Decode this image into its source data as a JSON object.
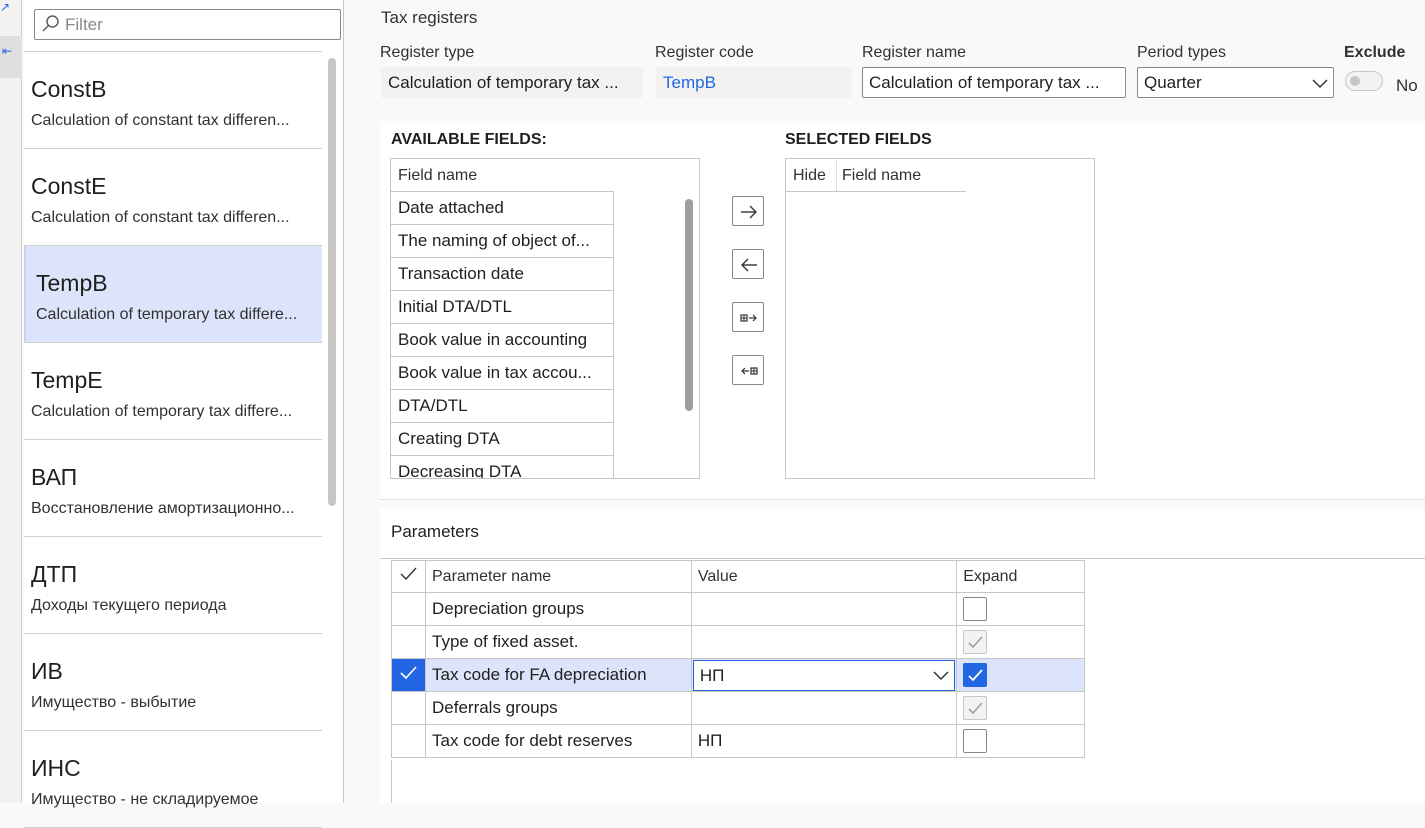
{
  "filter": {
    "placeholder": "Filter"
  },
  "list": [
    {
      "title": "ConstB",
      "desc": "Calculation of constant tax differen..."
    },
    {
      "title": "ConstE",
      "desc": "Calculation of constant tax differen..."
    },
    {
      "title": "TempB",
      "desc": "Calculation of temporary tax differe...",
      "selected": true
    },
    {
      "title": "TempE",
      "desc": "Calculation of temporary tax differe..."
    },
    {
      "title": "ВАП",
      "desc": "Восстановление амортизационно..."
    },
    {
      "title": "ДТП",
      "desc": "Доходы текущего периода"
    },
    {
      "title": "ИВ",
      "desc": "Имущество - выбытие"
    },
    {
      "title": "ИНС",
      "desc": "Имущество - не складируемое"
    }
  ],
  "header": {
    "page_title": "Tax registers",
    "register_type_label": "Register type",
    "register_type_value": "Calculation of temporary tax ...",
    "register_code_label": "Register code",
    "register_code_value": "TempB",
    "register_name_label": "Register name",
    "register_name_value": "Calculation of temporary tax ...",
    "period_types_label": "Period types",
    "period_types_value": "Quarter",
    "exclude_label": "Exclude",
    "exclude_value": "No"
  },
  "fields": {
    "available_title": "AVAILABLE FIELDS:",
    "selected_title": "SELECTED FIELDS",
    "field_name_header": "Field name",
    "hide_header": "Hide",
    "available": [
      "Date attached",
      "The naming of object of...",
      "Transaction date",
      "Initial DTA/DTL",
      "Book value in accounting",
      "Book value in tax accou...",
      "DTA/DTL",
      "Creating DTA",
      "Decreasing DTA"
    ]
  },
  "parameters": {
    "title": "Parameters",
    "col_name": "Parameter name",
    "col_value": "Value",
    "col_expand": "Expand",
    "rows": [
      {
        "name": "Depreciation groups",
        "value": "",
        "expand": "unchecked"
      },
      {
        "name": "Type of fixed asset.",
        "value": "",
        "expand": "disabled-checked"
      },
      {
        "name": "Tax code for FA depreciation",
        "value": "НП",
        "expand": "checked",
        "selected": true
      },
      {
        "name": "Deferrals groups",
        "value": "",
        "expand": "disabled-checked"
      },
      {
        "name": "Tax code for debt reserves",
        "value": "НП",
        "expand": "unchecked"
      }
    ]
  },
  "colors": {
    "accent": "#2266e3",
    "selected_row": "#dbe4fa"
  }
}
